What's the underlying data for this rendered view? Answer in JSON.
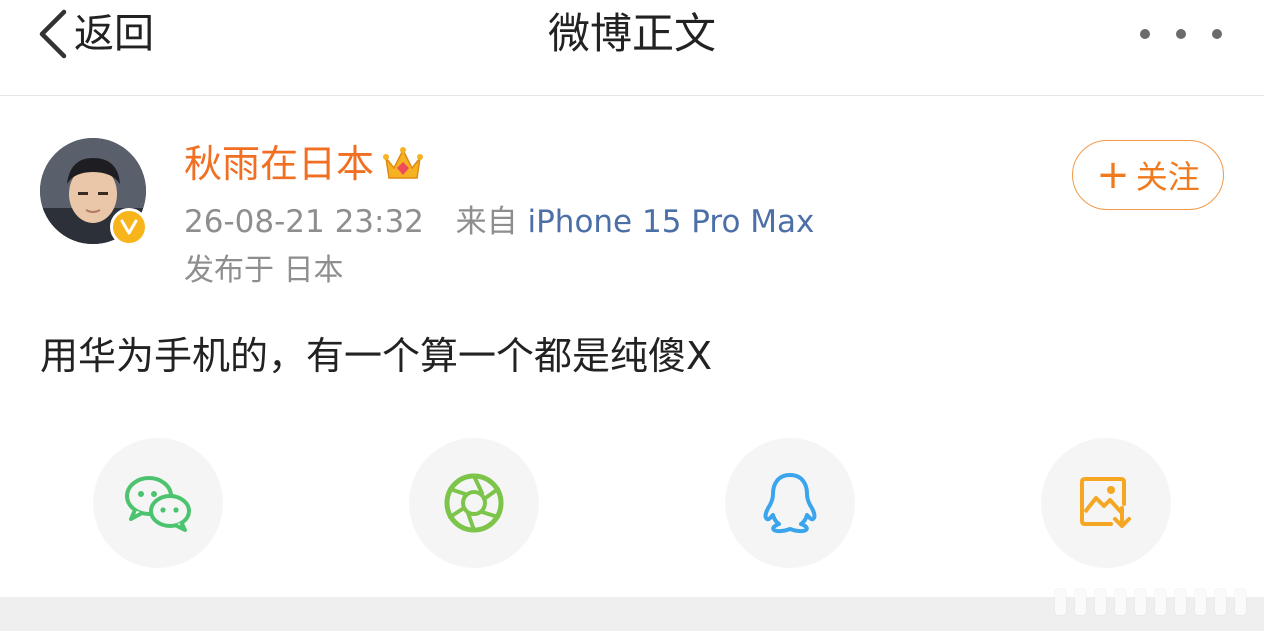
{
  "header": {
    "back_label": "返回",
    "title": "微博正文"
  },
  "post": {
    "author_name": "秋雨在日本",
    "timestamp": "26-08-21 23:32",
    "source_prefix": "来自",
    "source_device": "iPhone 15 Pro Max",
    "location_label": "发布于 日本",
    "follow_label": "关注",
    "content": "用华为手机的，有一个算一个都是纯傻X"
  },
  "share_targets": [
    {
      "icon": "wechat-icon",
      "color": "#4cc36f"
    },
    {
      "icon": "moments-icon",
      "color": "#7cc54a"
    },
    {
      "icon": "qq-icon",
      "color": "#3aa4ec"
    },
    {
      "icon": "save-image-icon",
      "color": "#f5a623"
    }
  ],
  "colors": {
    "name": "#f06f22",
    "follow": "#f07a1e",
    "source": "#4b6fa6",
    "verified_badge": "#f8b51b"
  }
}
